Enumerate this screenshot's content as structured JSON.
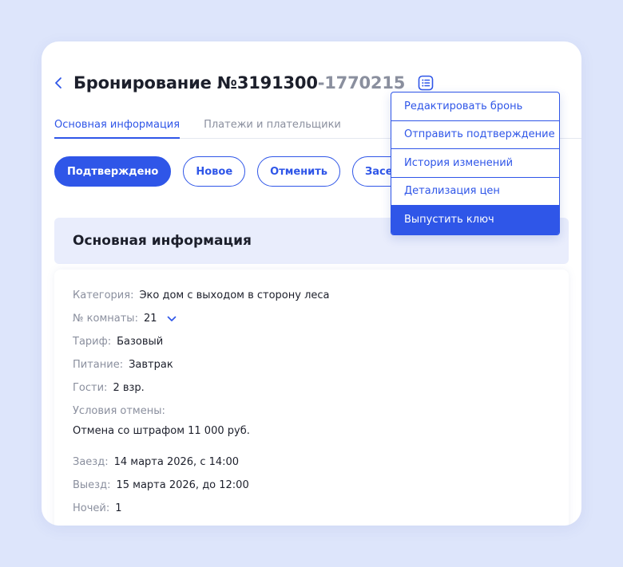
{
  "colors": {
    "accent": "#2f56e8",
    "background": "#dde5fb",
    "section_header_bg": "#e9edfc",
    "muted_text": "#8a8f9e"
  },
  "header": {
    "back_icon": "chevron-left-icon",
    "title_main": "Бронирование №3191300",
    "title_suffix": "-1770215",
    "menu_icon": "list-menu-icon"
  },
  "tabs": [
    {
      "label": "Основная информация",
      "active": true
    },
    {
      "label": "Платежи и плательщики",
      "active": false
    }
  ],
  "actions": [
    {
      "label": "Подтверждено",
      "primary": true
    },
    {
      "label": "Новое",
      "primary": false
    },
    {
      "label": "Отменить",
      "primary": false
    },
    {
      "label": "Заселить",
      "primary": false
    }
  ],
  "dropdown": {
    "items": [
      {
        "label": "Редактировать бронь",
        "active": false
      },
      {
        "label": "Отправить подтверждение",
        "active": false
      },
      {
        "label": "История изменений",
        "active": false
      },
      {
        "label": "Детализация цен",
        "active": false
      },
      {
        "label": "Выпустить ключ",
        "active": true
      }
    ]
  },
  "section": {
    "title": "Основная информация"
  },
  "info": {
    "category": {
      "label": "Категория:",
      "value": "Эко дом с выходом в сторону леса"
    },
    "room": {
      "label": "№ комнаты:",
      "value": "21"
    },
    "tariff": {
      "label": "Тариф:",
      "value": "Базовый"
    },
    "meals": {
      "label": "Питание:",
      "value": "Завтрак"
    },
    "guests": {
      "label": "Гости:",
      "value": "2 взр."
    },
    "cancellation": {
      "label": "Условия отмены:",
      "value": "Отмена со штрафом 11 000 руб."
    },
    "checkin": {
      "label": "Заезд:",
      "value": "14 марта 2026, с 14:00"
    },
    "checkout": {
      "label": "Выезд:",
      "value": "15 марта 2026, до 12:00"
    },
    "nights": {
      "label": "Ночей:",
      "value": "1"
    }
  }
}
